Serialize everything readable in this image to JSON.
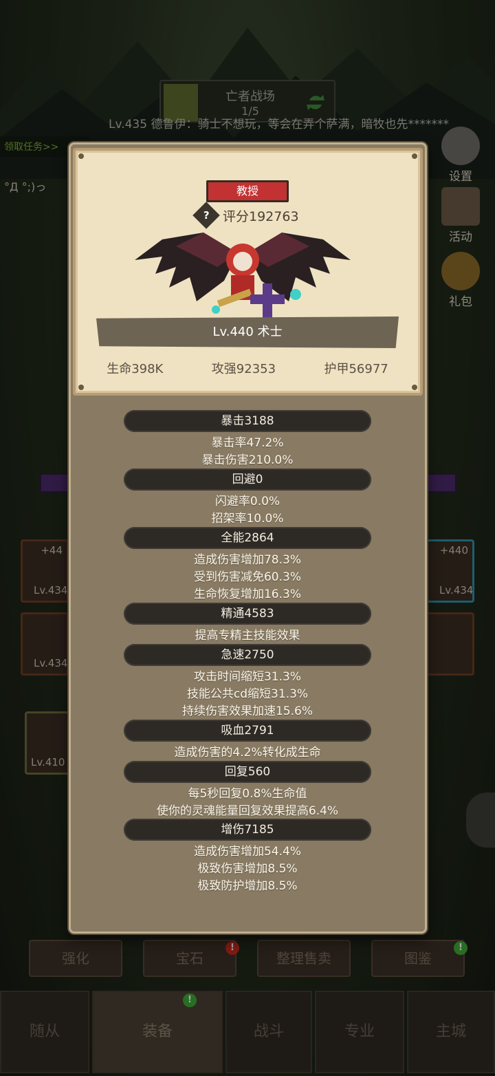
{
  "stage": {
    "name": "亡者战场",
    "progress": "1/5"
  },
  "chat": {
    "line": "Lv.435 德鲁伊：骑士不想玩，等会在弄个萨满，暗牧也先*******"
  },
  "quest": {
    "label": "领取任务>>"
  },
  "emote": "°Д °;)っ",
  "side_buttons": {
    "settings": "设置",
    "activity": "活动",
    "gift": "礼包"
  },
  "items": {
    "left_top": {
      "plus": "+44",
      "level": "Lv.434"
    },
    "left_bottom": {
      "level": "Lv.434"
    },
    "right_top": {
      "plus": "+440",
      "level": "Lv.434"
    },
    "lower": {
      "level": "Lv.410"
    }
  },
  "bottom_tabs": [
    "强化",
    "宝石",
    "整理售卖",
    "图鉴"
  ],
  "nav": {
    "items": [
      "随从",
      "装备",
      "战斗",
      "专业",
      "主城"
    ]
  },
  "badges": {
    "alert": "!"
  },
  "card": {
    "title": "教授",
    "score": "评分192763",
    "level_class": "Lv.440 术士",
    "stats": [
      {
        "label": "生命398K"
      },
      {
        "label": "攻强92353"
      },
      {
        "label": "护甲56977"
      }
    ]
  },
  "sections": [
    {
      "header": "暴击3188",
      "lines": [
        "暴击率47.2%",
        "暴击伤害210.0%"
      ]
    },
    {
      "header": "回避0",
      "lines": [
        "闪避率0.0%",
        "招架率10.0%"
      ]
    },
    {
      "header": "全能2864",
      "lines": [
        "造成伤害增加78.3%",
        "受到伤害减免60.3%",
        "生命恢复增加16.3%"
      ]
    },
    {
      "header": "精通4583",
      "lines": [
        "提高专精主技能效果"
      ]
    },
    {
      "header": "急速2750",
      "lines": [
        "攻击时间缩短31.3%",
        "技能公共cd缩短31.3%",
        "持续伤害效果加速15.6%"
      ]
    },
    {
      "header": "吸血2791",
      "lines": [
        "造成伤害的4.2%转化成生命"
      ]
    },
    {
      "header": "回复560",
      "lines": [
        "每5秒回复0.8%生命值",
        "使你的灵魂能量回复效果提高6.4%"
      ]
    },
    {
      "header": "增伤7185",
      "lines": [
        "造成伤害增加54.4%",
        "极致伤害增加8.5%",
        "极致防护增加8.5%"
      ]
    }
  ]
}
